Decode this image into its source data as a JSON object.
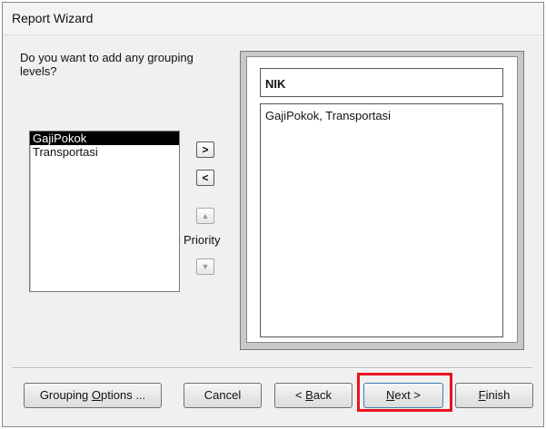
{
  "window": {
    "title": "Report Wizard"
  },
  "prompt": "Do you want to add any grouping levels?",
  "fields": [
    {
      "label": "GajiPokok",
      "selected": true
    },
    {
      "label": "Transportasi",
      "selected": false
    }
  ],
  "controls": {
    "add": ">",
    "remove": "<",
    "priority_up": "▲",
    "priority_down": "▼",
    "priority_label": "Priority"
  },
  "preview": {
    "group_header": "NIK",
    "detail": "GajiPokok, Transportasi"
  },
  "buttons": {
    "grouping_options": {
      "pre": "Grouping ",
      "u": "O",
      "post": "ptions ..."
    },
    "cancel": {
      "pre": "Cancel",
      "u": "",
      "post": ""
    },
    "back": {
      "pre": "< ",
      "u": "B",
      "post": "ack"
    },
    "next": {
      "pre": "",
      "u": "N",
      "post": "ext >"
    },
    "finish": {
      "pre": "",
      "u": "F",
      "post": "inish"
    }
  },
  "highlight_color": "#e8141c"
}
